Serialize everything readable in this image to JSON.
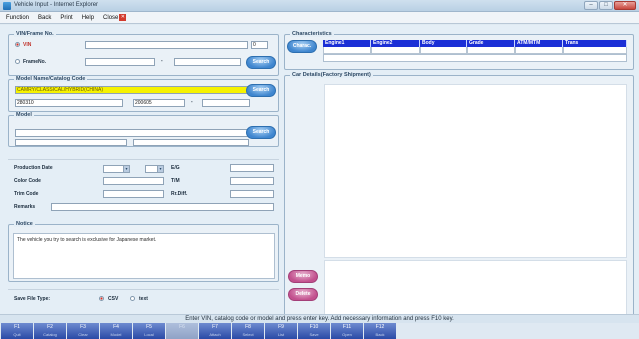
{
  "window": {
    "title": "Vehicle Input - Internet Explorer"
  },
  "menu": {
    "items": [
      "Function",
      "Back",
      "Print",
      "Help",
      "Close"
    ]
  },
  "vin_panel": {
    "legend": "VIN/Frame No.",
    "vin_label": "VIN",
    "vin_value": "",
    "vin_count": "0",
    "frame_label": "FrameNo.",
    "frame_dash": "-",
    "search_label": "Search"
  },
  "model_name_panel": {
    "legend": "Model Name/Catalog Code",
    "selected_model": "CAMRY/CLASSICAL/HYBRID(CHINA)",
    "catalog_code": "280310",
    "date_code": "200605",
    "dash": "-",
    "search_label": "Search"
  },
  "model_panel": {
    "legend": "Model",
    "search_label": "Search"
  },
  "detail_panel": {
    "production_date": "Production Date",
    "eg": "E/G",
    "color_code": "Color Code",
    "tm": "T/M",
    "trim_code": "Trim Code",
    "rr_diff": "Rr.Diff.",
    "remarks": "Remarks"
  },
  "notice_panel": {
    "legend": "Notice",
    "text": "The vehicle you try to search is exclusive for Japanese market."
  },
  "save_panel": {
    "label": "Save File Type:",
    "option_csv": "CSV",
    "option_text": "text"
  },
  "characteristics": {
    "legend": "Characteristics",
    "button_label": "Charac.",
    "columns": [
      "Engine1",
      "Engine2",
      "Body",
      "Grade",
      "ATM/MTM",
      "Trans"
    ]
  },
  "car_details": {
    "legend": "Car Details(Factory Shipment)"
  },
  "side_buttons": {
    "memo": "Memo",
    "delete": "Delete"
  },
  "status_message": "Enter VIN, catalog code or model and press enter key. Add necessary information and press F10 key.",
  "function_keys": [
    {
      "key": "F1",
      "sub": "Quit",
      "enabled": true
    },
    {
      "key": "F2",
      "sub": "Catalog",
      "enabled": true
    },
    {
      "key": "F3",
      "sub": "Clear",
      "enabled": true
    },
    {
      "key": "F4",
      "sub": "Model",
      "enabled": true
    },
    {
      "key": "F5",
      "sub": "Local",
      "enabled": true
    },
    {
      "key": "F6",
      "sub": "",
      "enabled": false
    },
    {
      "key": "F7",
      "sub": "Attach",
      "enabled": true
    },
    {
      "key": "F8",
      "sub": "Select",
      "enabled": true
    },
    {
      "key": "F9",
      "sub": "List",
      "enabled": true
    },
    {
      "key": "F10",
      "sub": "Save",
      "enabled": true
    },
    {
      "key": "F11",
      "sub": "Open",
      "enabled": true
    },
    {
      "key": "F12",
      "sub": "Back",
      "enabled": true
    }
  ],
  "colors": {
    "grid_header": "#1b2fd6",
    "selected_model_bg": "#f6f200",
    "search_button": "#3f86cf",
    "delete_button": "#c2508e",
    "fkey": "#2a4aa6"
  }
}
